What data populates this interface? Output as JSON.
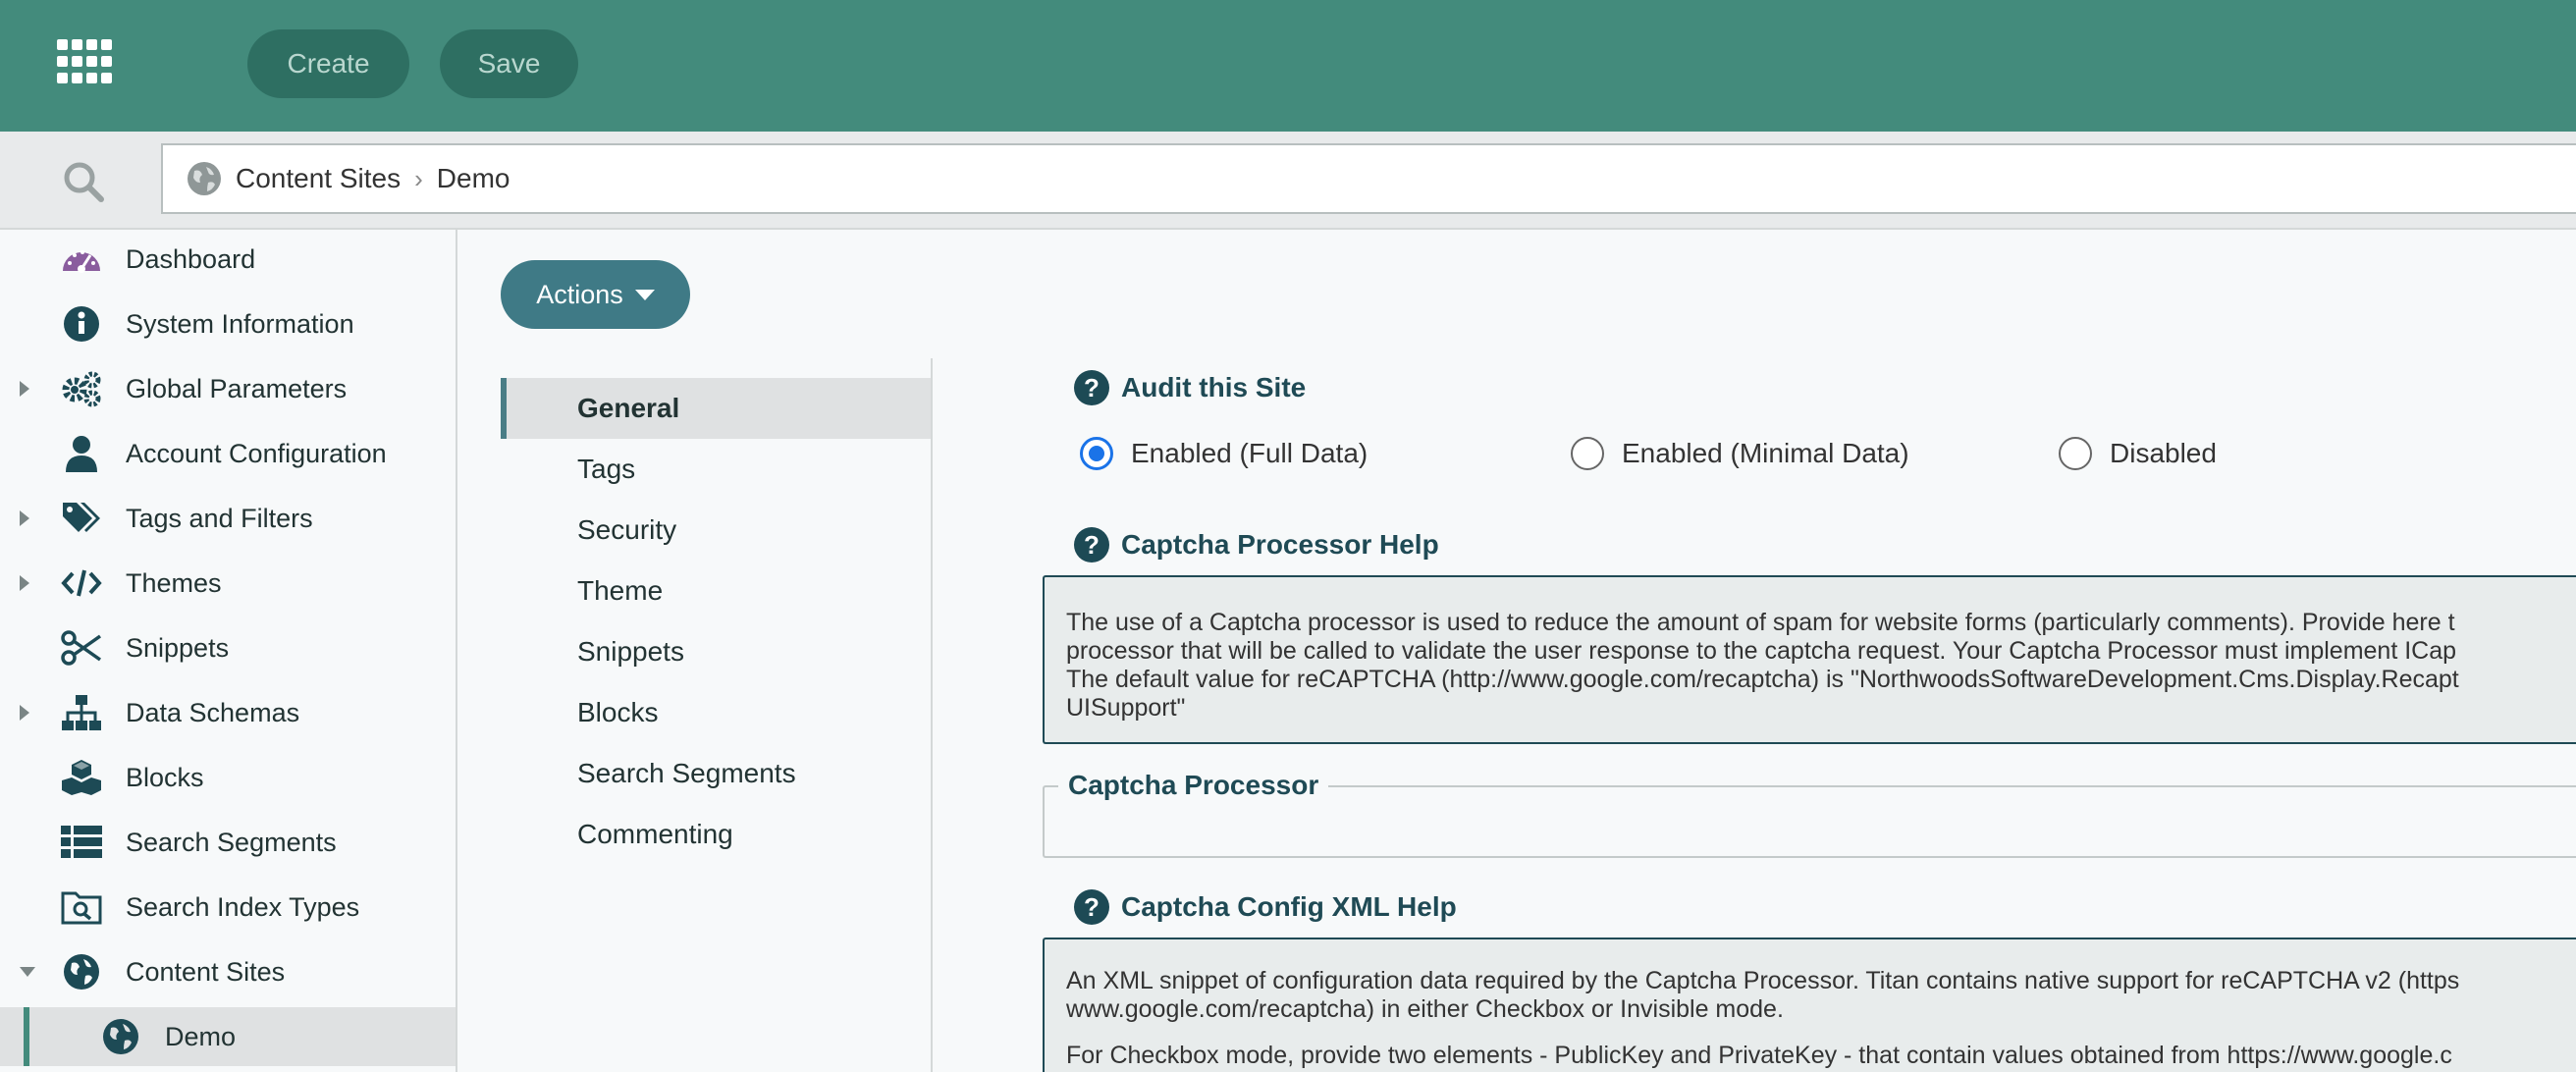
{
  "topbar": {
    "apps_icon": "grid-apps-icon",
    "create_label": "Create",
    "save_label": "Save"
  },
  "breadcrumb": {
    "items": [
      "Content Sites",
      "Demo"
    ]
  },
  "sidebar": {
    "items": [
      {
        "label": "Dashboard",
        "icon": "dashboard-gauge-icon"
      },
      {
        "label": "System Information",
        "icon": "info-circle-icon"
      },
      {
        "label": "Global Parameters",
        "icon": "gears-icon"
      },
      {
        "label": "Account Configuration",
        "icon": "user-icon"
      },
      {
        "label": "Tags and Filters",
        "icon": "tags-icon"
      },
      {
        "label": "Themes",
        "icon": "code-icon"
      },
      {
        "label": "Snippets",
        "icon": "scissors-icon"
      },
      {
        "label": "Data Schemas",
        "icon": "sitemap-icon"
      },
      {
        "label": "Blocks",
        "icon": "cubes-icon"
      },
      {
        "label": "Search Segments",
        "icon": "list-icon"
      },
      {
        "label": "Search Index Types",
        "icon": "folder-search-icon"
      },
      {
        "label": "Content Sites",
        "icon": "globe-icon"
      },
      {
        "label": "Demo",
        "icon": "globe-icon"
      }
    ]
  },
  "actions": {
    "label": "Actions"
  },
  "tabs": [
    "General",
    "Tags",
    "Security",
    "Theme",
    "Snippets",
    "Blocks",
    "Search Segments",
    "Commenting"
  ],
  "form": {
    "audit_title": "Audit this Site",
    "audit_options": [
      "Enabled (Full Data)",
      "Enabled (Minimal Data)",
      "Disabled"
    ],
    "audit_selected": "Enabled (Full Data)",
    "captcha_help_title": "Captcha Processor Help",
    "captcha_help_lines": [
      "The use of a Captcha processor is used to reduce the amount of spam for website forms (particularly comments). Provide here t",
      "processor that will be called to validate the user response to the captcha request. Your Captcha Processor must implement ICap",
      "The default value for reCAPTCHA (http://www.google.com/recaptcha) is \"NorthwoodsSoftwareDevelopment.Cms.Display.Recapt",
      "UISupport\""
    ],
    "captcha_processor_label": "Captcha Processor",
    "captcha_processor_value": "",
    "config_help_title": "Captcha Config XML Help",
    "config_help_lines": [
      "An XML snippet of configuration data required by the Captcha Processor. Titan contains native support for reCAPTCHA v2 (https",
      "www.google.com/recaptcha) in either Checkbox or Invisible mode.",
      "For Checkbox mode, provide two elements - PublicKey and PrivateKey - that contain values obtained from https://www.google.c"
    ]
  }
}
